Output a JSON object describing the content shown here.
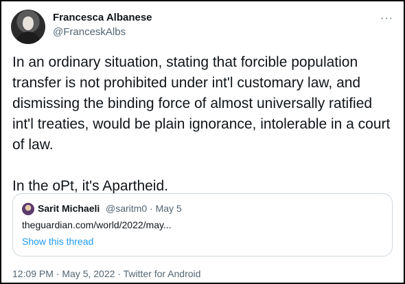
{
  "tweet": {
    "author_name": "Francesca Albanese",
    "author_handle": "@FranceskAlbs",
    "more_icon": "more-icon",
    "text_p1": "In an ordinary situation, stating that forcible population transfer is not prohibited under int'l customary law, and dismissing the binding force of almost universally ratified int'l treaties,  would be plain ignorance, intolerable in a court of law.",
    "text_p2": "In the oPt, it's Apartheid.",
    "timestamp": "12:09 PM · May 5, 2022 · Twitter for Android"
  },
  "quoted": {
    "author_name": "Sarit Michaeli",
    "author_meta": "@saritm0 · May 5",
    "text": "theguardian.com/world/2022/may...",
    "thread_link": "Show this thread"
  },
  "colors": {
    "text": "#0f1419",
    "secondary": "#536471",
    "link": "#1d9bf0",
    "border": "#cfd9de"
  }
}
